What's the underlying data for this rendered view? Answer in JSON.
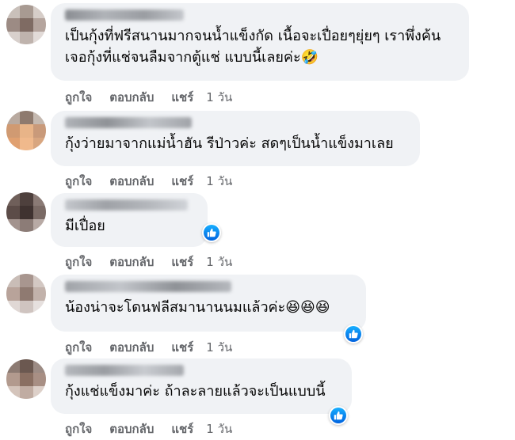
{
  "actions": {
    "like": "ถูกใจ",
    "reply": "ตอบกลับ",
    "share": "แชร์",
    "time": "1 วัน"
  },
  "comments": [
    {
      "text": "เป็นกุ้งที่ฟรีสนานมากจนน้ำแข็งกัด เนื้อจะเปื่อยๆยุ่ยๆ เราพึ่งค้น\nเจอกุ้งที่แช่จนลืมจากตู้แช่ แบบนี้เลยค่ะ🤣",
      "reaction": ""
    },
    {
      "text": "กุ้งว่ายมาจากแม่น้ำฮัน รีป่าวค่ะ สดๆเป็นน้ำแข็งมาเลย",
      "reaction": ""
    },
    {
      "text": "มีเปื่อย",
      "reaction": "like"
    },
    {
      "text": "น้องน่าจะโดนฟลีสมานานนมแล้วค่ะ😆😆😆",
      "reaction": "like"
    },
    {
      "text": "กุ้งแช่แข็งมาค่ะ ถ้าละลายแล้วจะเป็นแบบนี้",
      "reaction": "like"
    }
  ],
  "colors": {
    "bubble": "#f0f2f5",
    "meta": "#65676b",
    "like_blue": "#1877f2"
  }
}
